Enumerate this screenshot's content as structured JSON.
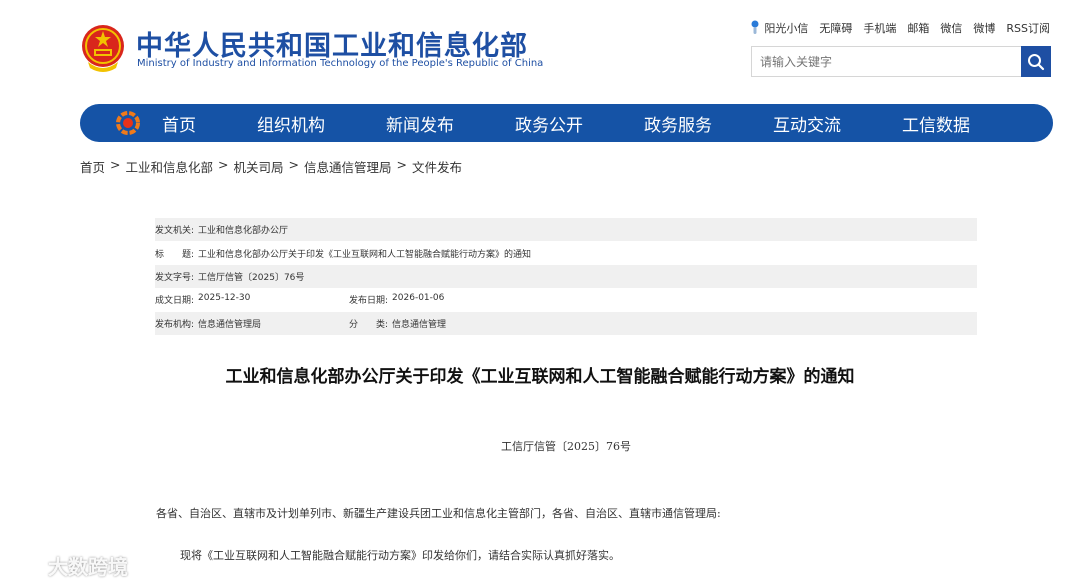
{
  "header": {
    "title_cn": "中华人民共和国工业和信息化部",
    "title_en": "Ministry of Industry and Information Technology of the People's Republic of China",
    "links": [
      "阳光小信",
      "无障碍",
      "手机端",
      "邮箱",
      "微信",
      "微博",
      "RSS订阅"
    ]
  },
  "search": {
    "placeholder": "请输入关键字"
  },
  "nav": {
    "items": [
      "首页",
      "组织机构",
      "新闻发布",
      "政务公开",
      "政务服务",
      "互动交流",
      "工信数据"
    ]
  },
  "breadcrumb": [
    "首页",
    "工业和信息化部",
    "机关司局",
    "信息通信管理局",
    "文件发布"
  ],
  "meta": {
    "issuer_label": "发文机关:",
    "issuer": "工业和信息化部办公厅",
    "title_label": "标　　题:",
    "title": "工业和信息化部办公厅关于印发《工业互联网和人工智能融合赋能行动方案》的通知",
    "docno_label": "发文字号:",
    "docno": "工信厅信管〔2025〕76号",
    "written_label": "成文日期:",
    "written": "2025-12-30",
    "published_label": "发布日期:",
    "published": "2026-01-06",
    "org_label": "发布机构:",
    "org": "信息通信管理局",
    "category_label": "分　　类:",
    "category": "信息通信管理"
  },
  "document": {
    "title": "工业和信息化部办公厅关于印发《工业互联网和人工智能融合赋能行动方案》的通知",
    "number": "工信厅信管〔2025〕76号",
    "addressee": "各省、自治区、直辖市及计划单列市、新疆生产建设兵团工业和信息化主管部门，各省、自治区、直辖市通信管理局:",
    "body": "现将《工业互联网和人工智能融合赋能行动方案》印发给你们，请结合实际认真抓好落实。"
  },
  "watermark": {
    "text": "大数跨境"
  },
  "colors": {
    "brand_blue": "#1553a6",
    "title_blue": "#1e4fa3",
    "meta_shade": "#f0f0f0"
  }
}
